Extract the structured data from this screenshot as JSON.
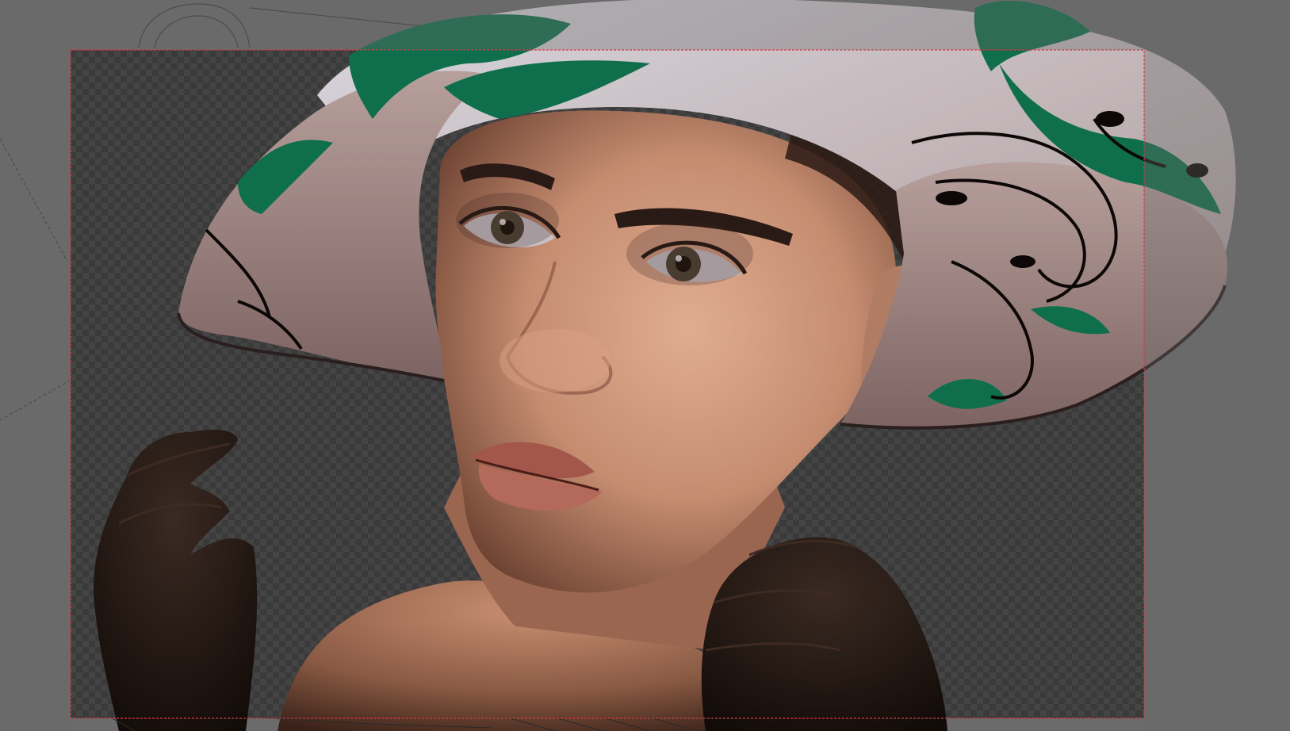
{
  "viewport": {
    "background_color": "#6b6b6b",
    "camera_frame_color": "#d23c46",
    "transparent_checker_dark": "#3a3a3a",
    "transparent_checker_light": "#454545"
  },
  "render": {
    "subject": "portrait",
    "hat_color": "#c9c4c8",
    "hat_pattern_color": "#0f6e4b",
    "skin_color": "#c9977e",
    "glove_color": "#1d130f"
  }
}
